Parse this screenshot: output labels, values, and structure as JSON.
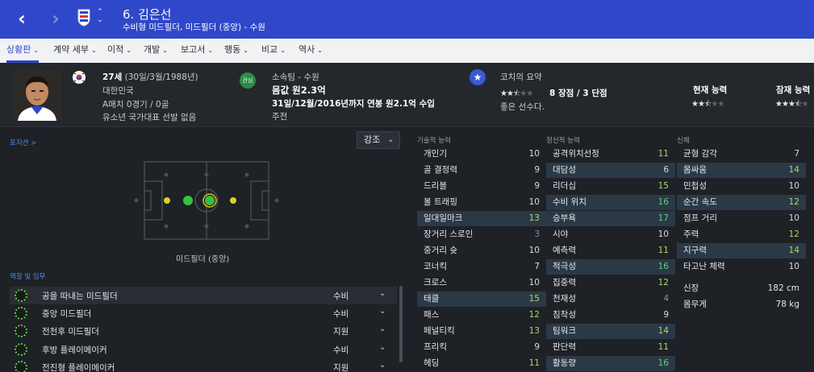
{
  "header": {
    "title": "6. 김은선",
    "subtitle": "수비형 미드필더, 미드필더 (중앙) - 수원"
  },
  "tabs": [
    {
      "label": "상황판",
      "active": true
    },
    {
      "label": "계약 세부",
      "active": false
    },
    {
      "label": "이적",
      "active": false
    },
    {
      "label": "개발",
      "active": false
    },
    {
      "label": "보고서",
      "active": false
    },
    {
      "label": "행동",
      "active": false
    },
    {
      "label": "비교",
      "active": false
    },
    {
      "label": "역사",
      "active": false
    }
  ],
  "profile": {
    "age": "27세",
    "birth": "(30일/3월/1988년)",
    "nation": "대한민국",
    "caps": "A매치 0경기 / 0골",
    "youth": "유소년 국가대표 선발 없음"
  },
  "club": {
    "badge_text": "관심",
    "team": "소속팀 - 수원",
    "value": "몸값 원2.3억",
    "contract": "31일/12월/2016년까지 연봉 원2.1억 수입",
    "status": "주전"
  },
  "coach": {
    "title": "코치의 요약",
    "rating_stars": 2.5,
    "strengths": "8 장점 / 3 단점",
    "comment": "좋은 선수다."
  },
  "ability": {
    "current_label": "현재 능력",
    "current_stars": 2.5,
    "potential_label": "잠재 능력",
    "potential_stars": 3.5
  },
  "left": {
    "position_link": "포지션 >",
    "highlight_label": "강조",
    "position_label": "미드필더 (중앙)",
    "roles_heading": "역할 및 임무"
  },
  "roles": [
    {
      "name": "공을 따내는 미드필더",
      "duty": "수비"
    },
    {
      "name": "중앙 미드필더",
      "duty": "수비"
    },
    {
      "name": "전천후 미드필더",
      "duty": "지원"
    },
    {
      "name": "후방 플레이메이커",
      "duty": "수비"
    },
    {
      "name": "전진형 플레이메이커",
      "duty": "지원"
    }
  ],
  "technical": {
    "title": "기술적 능력",
    "items": [
      {
        "name": "개인기",
        "value": 10,
        "hl": false
      },
      {
        "name": "골 결정력",
        "value": 9,
        "hl": false
      },
      {
        "name": "드리블",
        "value": 9,
        "hl": false
      },
      {
        "name": "볼 트래핑",
        "value": 10,
        "hl": false
      },
      {
        "name": "일대일마크",
        "value": 13,
        "hl": true
      },
      {
        "name": "장거리 스로인",
        "value": 3,
        "hl": false
      },
      {
        "name": "중거리 슛",
        "value": 10,
        "hl": false
      },
      {
        "name": "코너킥",
        "value": 7,
        "hl": false
      },
      {
        "name": "크로스",
        "value": 10,
        "hl": false
      },
      {
        "name": "태클",
        "value": 15,
        "hl": true
      },
      {
        "name": "패스",
        "value": 12,
        "hl": false
      },
      {
        "name": "페널티킥",
        "value": 13,
        "hl": false
      },
      {
        "name": "프리킥",
        "value": 9,
        "hl": false
      },
      {
        "name": "헤딩",
        "value": 11,
        "hl": false
      }
    ]
  },
  "mental": {
    "title": "정신적 능력",
    "items": [
      {
        "name": "공격위치선정",
        "value": 11,
        "hl": false
      },
      {
        "name": "대담성",
        "value": 6,
        "hl": true
      },
      {
        "name": "리더십",
        "value": 15,
        "hl": false
      },
      {
        "name": "수비 위치",
        "value": 16,
        "hl": true
      },
      {
        "name": "승부욕",
        "value": 17,
        "hl": true
      },
      {
        "name": "시야",
        "value": 10,
        "hl": false
      },
      {
        "name": "예측력",
        "value": 11,
        "hl": false
      },
      {
        "name": "적극성",
        "value": 16,
        "hl": true
      },
      {
        "name": "집중력",
        "value": 12,
        "hl": false
      },
      {
        "name": "천재성",
        "value": 4,
        "hl": false
      },
      {
        "name": "침착성",
        "value": 9,
        "hl": false
      },
      {
        "name": "팀워크",
        "value": 14,
        "hl": true
      },
      {
        "name": "판단력",
        "value": 11,
        "hl": false
      },
      {
        "name": "활동량",
        "value": 16,
        "hl": true
      }
    ]
  },
  "physical": {
    "title": "신체",
    "items": [
      {
        "name": "균형 감각",
        "value": 7,
        "hl": false
      },
      {
        "name": "몸싸움",
        "value": 14,
        "hl": true
      },
      {
        "name": "민첩성",
        "value": 10,
        "hl": false
      },
      {
        "name": "순간 속도",
        "value": 12,
        "hl": true
      },
      {
        "name": "점프 거리",
        "value": 10,
        "hl": false
      },
      {
        "name": "주력",
        "value": 12,
        "hl": false
      },
      {
        "name": "지구력",
        "value": 14,
        "hl": true
      },
      {
        "name": "타고난 체력",
        "value": 10,
        "hl": false
      }
    ],
    "height_label": "신장",
    "height_value": "182 cm",
    "weight_label": "몸무게",
    "weight_value": "78 kg"
  },
  "colors": {
    "header": "#2f47c9",
    "attr_highlight": "#2b3947",
    "value_high": "#58d27b",
    "value_good": "#a8d86a"
  }
}
